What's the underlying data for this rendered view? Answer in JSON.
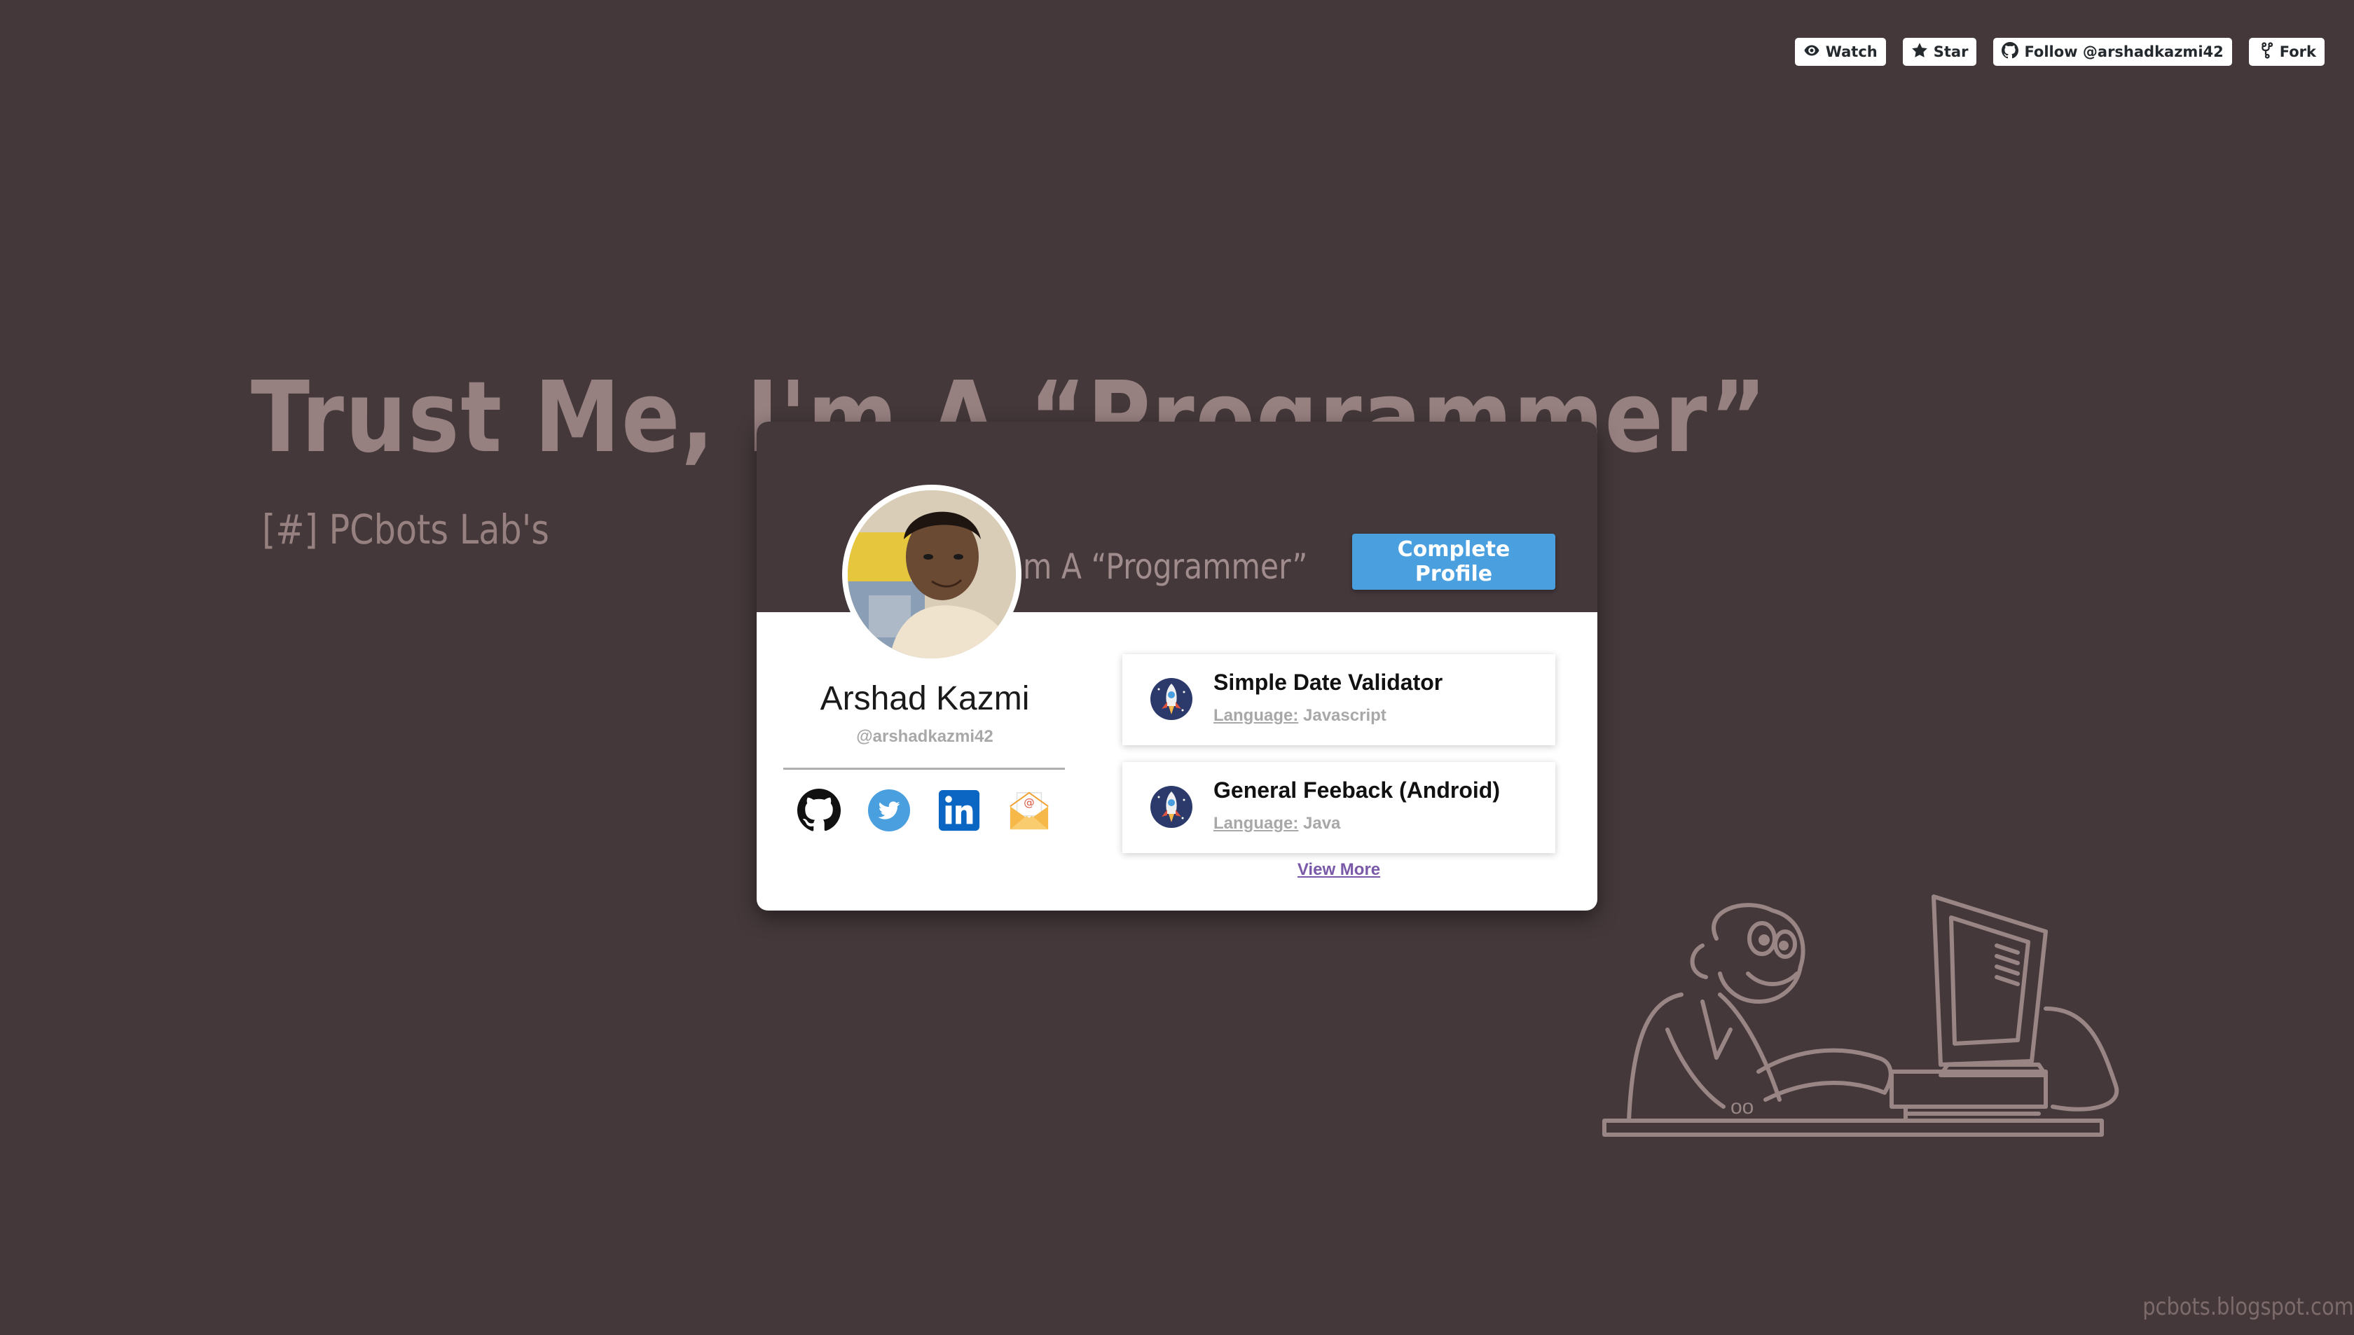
{
  "toolbar": {
    "watch_label": "Watch",
    "star_label": "Star",
    "follow_label": "Follow @arshadkazmi42",
    "fork_label": "Fork"
  },
  "background": {
    "title": "Trust Me, I'm A “Programmer”",
    "subtitle": "[#] PCbots Lab's",
    "watermark": "pcbots.blogspot.com"
  },
  "card": {
    "header_text": "m A “Programmer”",
    "complete_profile_label": "Complete Profile",
    "profile": {
      "name": "Arshad Kazmi",
      "handle": "@arshadkazmi42"
    },
    "socials": [
      "github-icon",
      "twitter-icon",
      "linkedin-icon",
      "email-icon"
    ],
    "projects": [
      {
        "title": "Simple Date Validator",
        "language_label": "Language:",
        "language": "Javascript",
        "icon": "rocket-icon"
      },
      {
        "title": "General Feeback (Android)",
        "language_label": "Language:",
        "language": "Java",
        "icon": "rocket-icon"
      }
    ],
    "view_more_label": "View More"
  },
  "colors": {
    "background": "#44383a",
    "accent_button": "#4a9fdf",
    "link": "#7a59a8",
    "hero_text": "#978080"
  }
}
